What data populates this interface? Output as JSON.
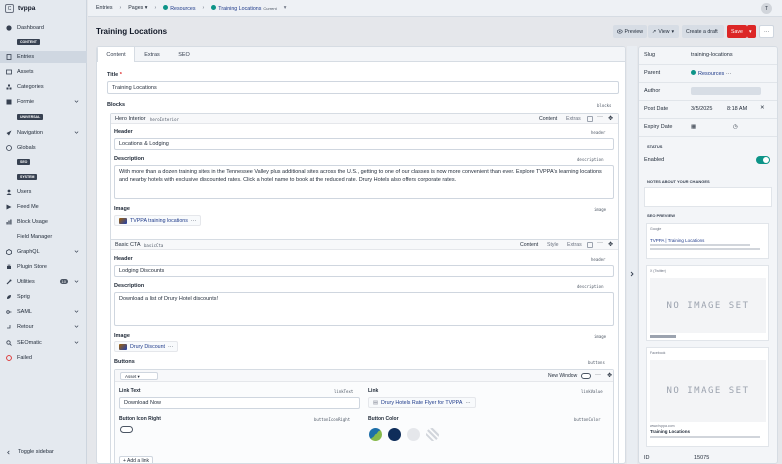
{
  "app": {
    "logo_letter": "C",
    "name": "tvppa"
  },
  "sidebar": {
    "items": [
      {
        "label": "Dashboard"
      },
      {
        "section": "CONTENT"
      },
      {
        "label": "Entries"
      },
      {
        "label": "Assets"
      },
      {
        "label": "Categories"
      },
      {
        "label": "Formie"
      },
      {
        "section": "UNIVERSAL"
      },
      {
        "label": "Navigation"
      },
      {
        "label": "Globals"
      },
      {
        "section": "SEO"
      },
      {
        "section": "SYSTEM"
      },
      {
        "label": "Users"
      },
      {
        "label": "Feed Me"
      },
      {
        "label": "Block Usage"
      },
      {
        "label": "Field Manager"
      },
      {
        "label": "GraphQL"
      },
      {
        "label": "Plugin Store"
      },
      {
        "label": "Utilities",
        "badge": "10"
      },
      {
        "label": "Sprig"
      },
      {
        "label": "SAML"
      },
      {
        "label": "Retour"
      },
      {
        "label": "SEOmatic"
      },
      {
        "label": "Failed"
      }
    ],
    "toggle_label": "Toggle sidebar"
  },
  "topbar": {
    "entries": "Entries",
    "pages": "Pages",
    "resources": "Resources",
    "training": "Training Locations",
    "current": "Current",
    "user_initial": "T"
  },
  "header": {
    "title": "Training Locations",
    "preview": "Preview",
    "view": "View",
    "create_draft": "Create a draft",
    "save": "Save",
    "more": "···"
  },
  "tabs": [
    "Content",
    "Extras",
    "SEO"
  ],
  "form": {
    "title_label": "Title",
    "title_value": "Training Locations",
    "blocks_label": "Blocks",
    "blocks_handle": "blocks",
    "hero": {
      "type": "Hero Interior",
      "handle": "heroInterior",
      "tab_content": "Content",
      "tab_extras": "Extras",
      "header_label": "Header",
      "header_handle": "header",
      "header_value": "Locations & Lodging",
      "desc_label": "Description",
      "desc_handle": "description",
      "desc_value": "With more than a dozen training sites in the Tennessee Valley plus additional sites across the U.S., getting to one of our classes is now more convenient than ever. Explore TVPPA's learning locations and nearby hotels with exclusive discounted rates. Click a hotel name to book at the reduced rate. Drury Hotels also offers corporate rates.",
      "image_label": "Image",
      "image_handle": "image",
      "image_asset": "TVPPA training locations"
    },
    "cta": {
      "type": "Basic CTA",
      "handle": "basicCta",
      "tab_content": "Content",
      "tab_style": "Style",
      "tab_extras": "Extras",
      "header_label": "Header",
      "header_handle": "header",
      "header_value": "Lodging Discounts",
      "desc_label": "Description",
      "desc_handle": "description",
      "desc_value": "Download a list of Drury Hotel discounts!",
      "image_label": "Image",
      "image_handle": "image",
      "image_asset": "Drury Discount",
      "buttons_label": "Buttons",
      "buttons_handle": "buttons",
      "asset_select": "Asset",
      "new_window": "New Window",
      "link_text_label": "Link Text",
      "link_text_handle": "linkText",
      "link_text_value": "Download Now",
      "link_label": "Link",
      "link_handle": "linkValue",
      "link_asset": "Drury Hotels Rate Flyer for TVPPA",
      "icon_right_label": "Button Icon Right",
      "icon_right_handle": "buttonIconRight",
      "color_label": "Button Color",
      "color_handle": "buttonColor",
      "add_link": "+ Add a link"
    }
  },
  "meta": {
    "slug_k": "Slug",
    "slug_v": "training-locations",
    "parent_k": "Parent",
    "parent_v": "Resources",
    "author_k": "Author",
    "post_date_k": "Post Date",
    "post_date_v": "3/5/2025",
    "post_time_v": "8:18 AM",
    "expiry_k": "Expiry Date",
    "status_title": "STATUS",
    "enabled": "Enabled",
    "notes_title": "NOTES ABOUT YOUR CHANGES",
    "seo_title": "SEO PREVIEW",
    "google": "Google",
    "google_title": "TVPPA | Training Locations",
    "twitter": "X (Twitter)",
    "facebook": "Facebook",
    "no_image": "NO IMAGE SET",
    "fb_domain": "www.tvppa.com",
    "fb_title": "Training Locations",
    "id_k": "ID",
    "id_v": "15075"
  },
  "colors": {
    "accent": "#0d9488",
    "save": "#dc2626",
    "swatches": [
      "#1e6fa8",
      "#0f2d5a",
      "#e5e7eb",
      "#d1d5db"
    ]
  }
}
